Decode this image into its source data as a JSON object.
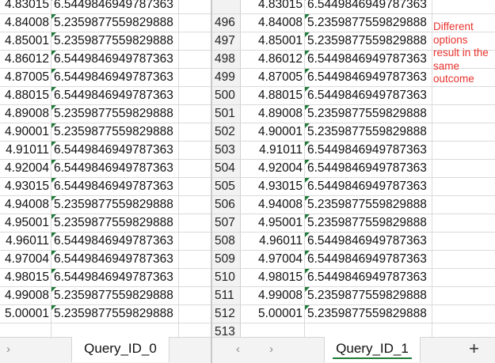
{
  "left_pane": {
    "rows": [
      {
        "x": "4.83015",
        "y": "6.5449846949787363"
      },
      {
        "x": "4.84008",
        "y": "5.2359877559829888"
      },
      {
        "x": "4.85001",
        "y": "5.2359877559829888"
      },
      {
        "x": "4.86012",
        "y": "6.5449846949787363"
      },
      {
        "x": "4.87005",
        "y": "6.5449846949787363"
      },
      {
        "x": "4.88015",
        "y": "6.5449846949787363"
      },
      {
        "x": "4.89008",
        "y": "5.2359877559829888"
      },
      {
        "x": "4.90001",
        "y": "5.2359877559829888"
      },
      {
        "x": "4.91011",
        "y": "6.5449846949787363"
      },
      {
        "x": "4.92004",
        "y": "6.5449846949787363"
      },
      {
        "x": "4.93015",
        "y": "6.5449846949787363"
      },
      {
        "x": "4.94008",
        "y": "5.2359877559829888"
      },
      {
        "x": "4.95001",
        "y": "5.2359877559829888"
      },
      {
        "x": "4.96011",
        "y": "6.5449846949787363"
      },
      {
        "x": "4.97004",
        "y": "6.5449846949787363"
      },
      {
        "x": "4.98015",
        "y": "6.5449846949787363"
      },
      {
        "x": "4.99008",
        "y": "5.2359877559829888"
      },
      {
        "x": "5.00001",
        "y": "5.2359877559829888"
      },
      {
        "x": "",
        "y": ""
      }
    ],
    "tab_nav_icon": "chevron-right-icon",
    "sheet_tab": "Query_ID_0"
  },
  "right_pane": {
    "rows": [
      {
        "n": "",
        "x": "4.83015",
        "y": "6.5449846949787363"
      },
      {
        "n": "496",
        "x": "4.84008",
        "y": "5.2359877559829888"
      },
      {
        "n": "497",
        "x": "4.85001",
        "y": "5.2359877559829888"
      },
      {
        "n": "498",
        "x": "4.86012",
        "y": "6.5449846949787363"
      },
      {
        "n": "499",
        "x": "4.87005",
        "y": "6.5449846949787363"
      },
      {
        "n": "500",
        "x": "4.88015",
        "y": "6.5449846949787363"
      },
      {
        "n": "501",
        "x": "4.89008",
        "y": "5.2359877559829888"
      },
      {
        "n": "502",
        "x": "4.90001",
        "y": "5.2359877559829888"
      },
      {
        "n": "503",
        "x": "4.91011",
        "y": "6.5449846949787363"
      },
      {
        "n": "504",
        "x": "4.92004",
        "y": "6.5449846949787363"
      },
      {
        "n": "505",
        "x": "4.93015",
        "y": "6.5449846949787363"
      },
      {
        "n": "506",
        "x": "4.94008",
        "y": "5.2359877559829888"
      },
      {
        "n": "507",
        "x": "4.95001",
        "y": "5.2359877559829888"
      },
      {
        "n": "508",
        "x": "4.96011",
        "y": "6.5449846949787363"
      },
      {
        "n": "509",
        "x": "4.97004",
        "y": "6.5449846949787363"
      },
      {
        "n": "510",
        "x": "4.98015",
        "y": "6.5449846949787363"
      },
      {
        "n": "511",
        "x": "4.99008",
        "y": "5.2359877559829888"
      },
      {
        "n": "512",
        "x": "5.00001",
        "y": "5.2359877559829888"
      },
      {
        "n": "513",
        "x": "",
        "y": ""
      }
    ],
    "annotation": "Different options result in the same outcome",
    "annotation_color": "#e8332f",
    "prev_icon": "chevron-left-icon",
    "next_icon": "chevron-right-icon",
    "sheet_tab": "Query_ID_1",
    "add_sheet_icon": "plus-icon",
    "add_sheet_label": "+"
  },
  "colors": {
    "gridline": "#dadada",
    "row_header_bg": "#f2f2f2",
    "tabbar_bg": "#f3f3f3",
    "active_tab_underline": "#1f7a3a",
    "text_flag": "#1f7a3a"
  }
}
